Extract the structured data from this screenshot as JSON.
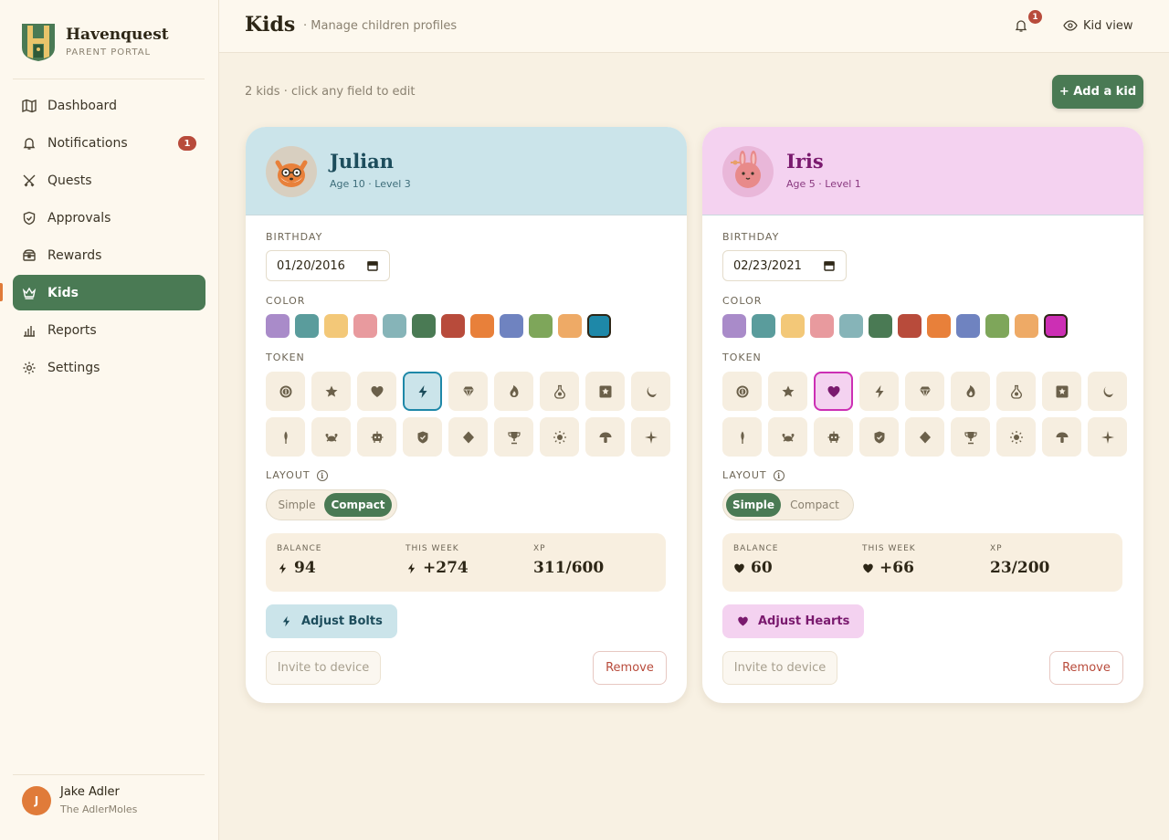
{
  "brand": {
    "name": "Havenquest",
    "subtitle": "PARENT PORTAL"
  },
  "nav": [
    {
      "label": "Dashboard",
      "icon": "map-icon"
    },
    {
      "label": "Notifications",
      "icon": "bell-icon",
      "badge": "1"
    },
    {
      "label": "Quests",
      "icon": "swords-icon"
    },
    {
      "label": "Approvals",
      "icon": "shield-check-icon"
    },
    {
      "label": "Rewards",
      "icon": "chest-icon"
    },
    {
      "label": "Kids",
      "icon": "crown-icon",
      "active": true
    },
    {
      "label": "Reports",
      "icon": "bar-chart-icon"
    },
    {
      "label": "Settings",
      "icon": "gear-icon"
    }
  ],
  "user": {
    "initial": "J",
    "name": "Jake Adler",
    "family": "The AdlerMoles"
  },
  "header": {
    "title": "Kids",
    "subtitle": "· Manage children profiles",
    "notif_count": "1",
    "kid_view": "Kid view"
  },
  "toolbar": {
    "count_text": "2 kids · click any field to edit",
    "add_label": "+ Add a kid"
  },
  "labels": {
    "birthday": "BIRTHDAY",
    "color": "COLOR",
    "token": "TOKEN",
    "layout": "LAYOUT",
    "info": "i",
    "layout_simple": "Simple",
    "layout_compact": "Compact",
    "balance": "BALANCE",
    "this_week": "THIS WEEK",
    "xp": "XP",
    "invite": "Invite to device",
    "remove": "Remove"
  },
  "palette": [
    "#a98bc9",
    "#5a9c9c",
    "#f3c878",
    "#e89a9e",
    "#86b4b8",
    "#4a7a54",
    "#b84b3b",
    "#e8803a",
    "#6f83c0",
    "#7ea65a",
    "#eeaa66"
  ],
  "token_icons": [
    "coin-icon",
    "star-icon",
    "heart-icon",
    "bolt-icon",
    "diamond-icon",
    "flame-icon",
    "potion-icon",
    "badge-star-icon",
    "moon-icon",
    "feather-icon",
    "crab-icon",
    "robot-icon",
    "shield-icon",
    "gem-icon",
    "trophy-icon",
    "sun-icon",
    "mushroom-icon",
    "sparkle-icon"
  ],
  "kids": [
    {
      "name": "Julian",
      "meta": "Age 10 · Level 3",
      "avatar": "fox-avatar",
      "birthday": "01/20/2016",
      "custom_color": "#1e88a8",
      "selected_token": "bolt-icon",
      "layout": "Compact",
      "balance": "94",
      "this_week": "+274",
      "xp": "311/600",
      "adjust_label": "Adjust Bolts",
      "theme": {
        "head_bg": "#cbe4ea",
        "name_color": "#1d4d5c",
        "meta_color": "#3e6d7a",
        "accent": "#1e88a8",
        "btn_bg": "#cbe4ea",
        "btn_fg": "#1d4d5c"
      }
    },
    {
      "name": "Iris",
      "meta": "Age 5 · Level 1",
      "avatar": "bunny-avatar",
      "birthday": "02/23/2021",
      "custom_color": "#cc2fb4",
      "selected_token": "heart-icon",
      "layout": "Simple",
      "balance": "60",
      "this_week": "+66",
      "xp": "23/200",
      "adjust_label": "Adjust Hearts",
      "theme": {
        "head_bg": "#f4d2f0",
        "name_color": "#7a1a6e",
        "meta_color": "#8a3a80",
        "accent": "#cc2fb4",
        "btn_bg": "#f4d2f0",
        "btn_fg": "#7a1a6e"
      }
    }
  ]
}
